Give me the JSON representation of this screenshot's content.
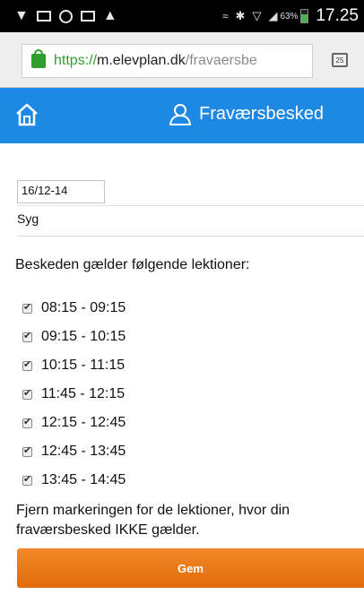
{
  "status_bar": {
    "battery": "63%",
    "time": "17.25"
  },
  "browser": {
    "url_scheme": "https://",
    "url_host": "m.elevplan.dk",
    "url_path": "/fravaersbe",
    "tabs_count": "25"
  },
  "header": {
    "title": "Fraværsbesked"
  },
  "form": {
    "date": "16/12-14",
    "reason": "Syg",
    "lessons_prompt": "Beskeden gælder følgende lektioner:",
    "lessons": [
      {
        "label": "08:15 - 09:15",
        "checked": true
      },
      {
        "label": "09:15 - 10:15",
        "checked": true
      },
      {
        "label": "10:15 - 11:15",
        "checked": true
      },
      {
        "label": "11:45 - 12:15",
        "checked": true
      },
      {
        "label": "12:15 - 12:45",
        "checked": true
      },
      {
        "label": "12:45 - 13:45",
        "checked": true
      },
      {
        "label": "13:45 - 14:45",
        "checked": true
      }
    ],
    "note_line1": "Fjern markeringen for de lektioner, hvor din",
    "note_line2": "fraværsbesked IKKE gælder.",
    "save_label": "Gem"
  },
  "colors": {
    "header_bg": "#1e88e5",
    "save_button": "#ee7d1f",
    "secure_green": "#2e9e2e"
  }
}
